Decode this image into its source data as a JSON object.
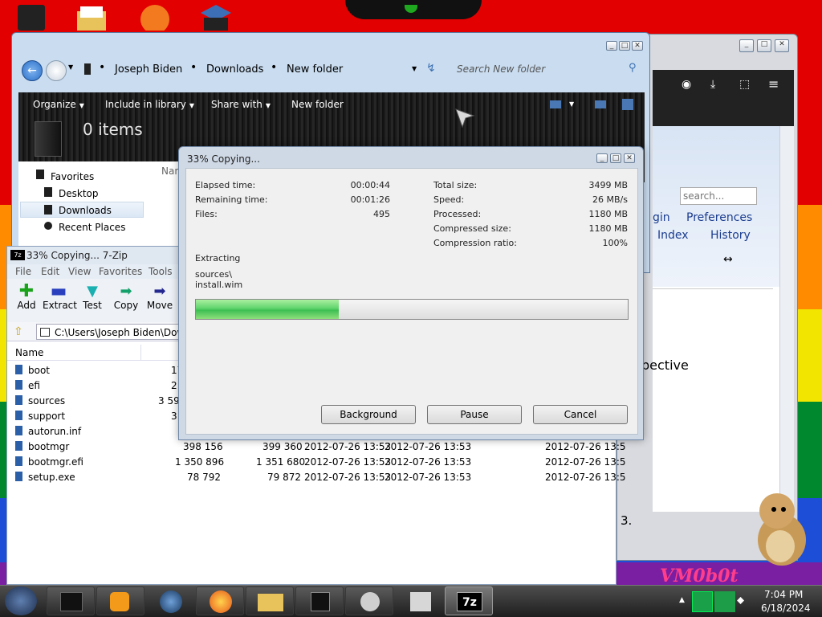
{
  "explorer": {
    "breadcrumb": [
      "Joseph Biden",
      "Downloads",
      "New folder"
    ],
    "search_placeholder": "Search New folder",
    "toolbar": {
      "organize": "Organize",
      "include": "Include in library",
      "share": "Share with",
      "new_folder": "New folder"
    },
    "items_count": "0 items",
    "nav": {
      "favorites": "Favorites",
      "desktop": "Desktop",
      "downloads": "Downloads",
      "recent": "Recent Places"
    },
    "col_name_partial": "Nan"
  },
  "browser": {
    "search_placeholder": "search...",
    "links": {
      "login": "gin",
      "preferences": "Preferences",
      "index": "Index",
      "history": "History"
    },
    "arrow": "↔",
    "word": "pective",
    "num": "3."
  },
  "zip": {
    "title": "33% Copying... 7-Zip",
    "menu": [
      "File",
      "Edit",
      "View",
      "Favorites",
      "Tools"
    ],
    "tools": {
      "add": "Add",
      "extract": "Extract",
      "test": "Test",
      "copy": "Copy",
      "move": "Move"
    },
    "path": "C:\\Users\\Joseph Biden\\Down",
    "col_name": "Name",
    "rows": [
      {
        "name": "boot",
        "size": "17"
      },
      {
        "name": "efi",
        "size": "2"
      },
      {
        "name": "sources",
        "size": "3 59"
      },
      {
        "name": "support",
        "size": "3"
      },
      {
        "name": "autorun.inf",
        "size": ""
      },
      {
        "name": "bootmgr",
        "size": "398 156",
        "packed": "399 360",
        "modified": "2012-07-26 13:53",
        "created": "2012-07-26 13:53",
        "accessed": "2012-07-26 13:5"
      },
      {
        "name": "bootmgr.efi",
        "size": "1 350 896",
        "packed": "1 351 680",
        "modified": "2012-07-26 13:53",
        "created": "2012-07-26 13:53",
        "accessed": "2012-07-26 13:5"
      },
      {
        "name": "setup.exe",
        "size": "78 792",
        "packed": "79 872",
        "modified": "2012-07-26 13:53",
        "created": "2012-07-26 13:53",
        "accessed": "2012-07-26 13:5"
      }
    ]
  },
  "dialog": {
    "title": "33% Copying...",
    "elapsed_label": "Elapsed time:",
    "elapsed": "00:00:44",
    "remaining_label": "Remaining time:",
    "remaining": "00:01:26",
    "files_label": "Files:",
    "files": "495",
    "total_label": "Total size:",
    "total": "3499 MB",
    "speed_label": "Speed:",
    "speed": "26 MB/s",
    "processed_label": "Processed:",
    "processed": "1180 MB",
    "compressed_label": "Compressed size:",
    "compressed": "1180 MB",
    "ratio_label": "Compression ratio:",
    "ratio": "100%",
    "action": "Extracting",
    "file_dir": "sources\\",
    "file_name": "install.wim",
    "progress": 0.33,
    "buttons": {
      "background": "Background",
      "pause": "Pause",
      "cancel": "Cancel"
    }
  },
  "taskbar": {
    "time": "7:04 PM",
    "date": "6/18/2024",
    "zip_label": "7z"
  },
  "watermark": "VM0b0t",
  "colors": {
    "progress": "#5fd46c",
    "taskbar": "#2b2b2b",
    "link": "#1a3c8f"
  }
}
